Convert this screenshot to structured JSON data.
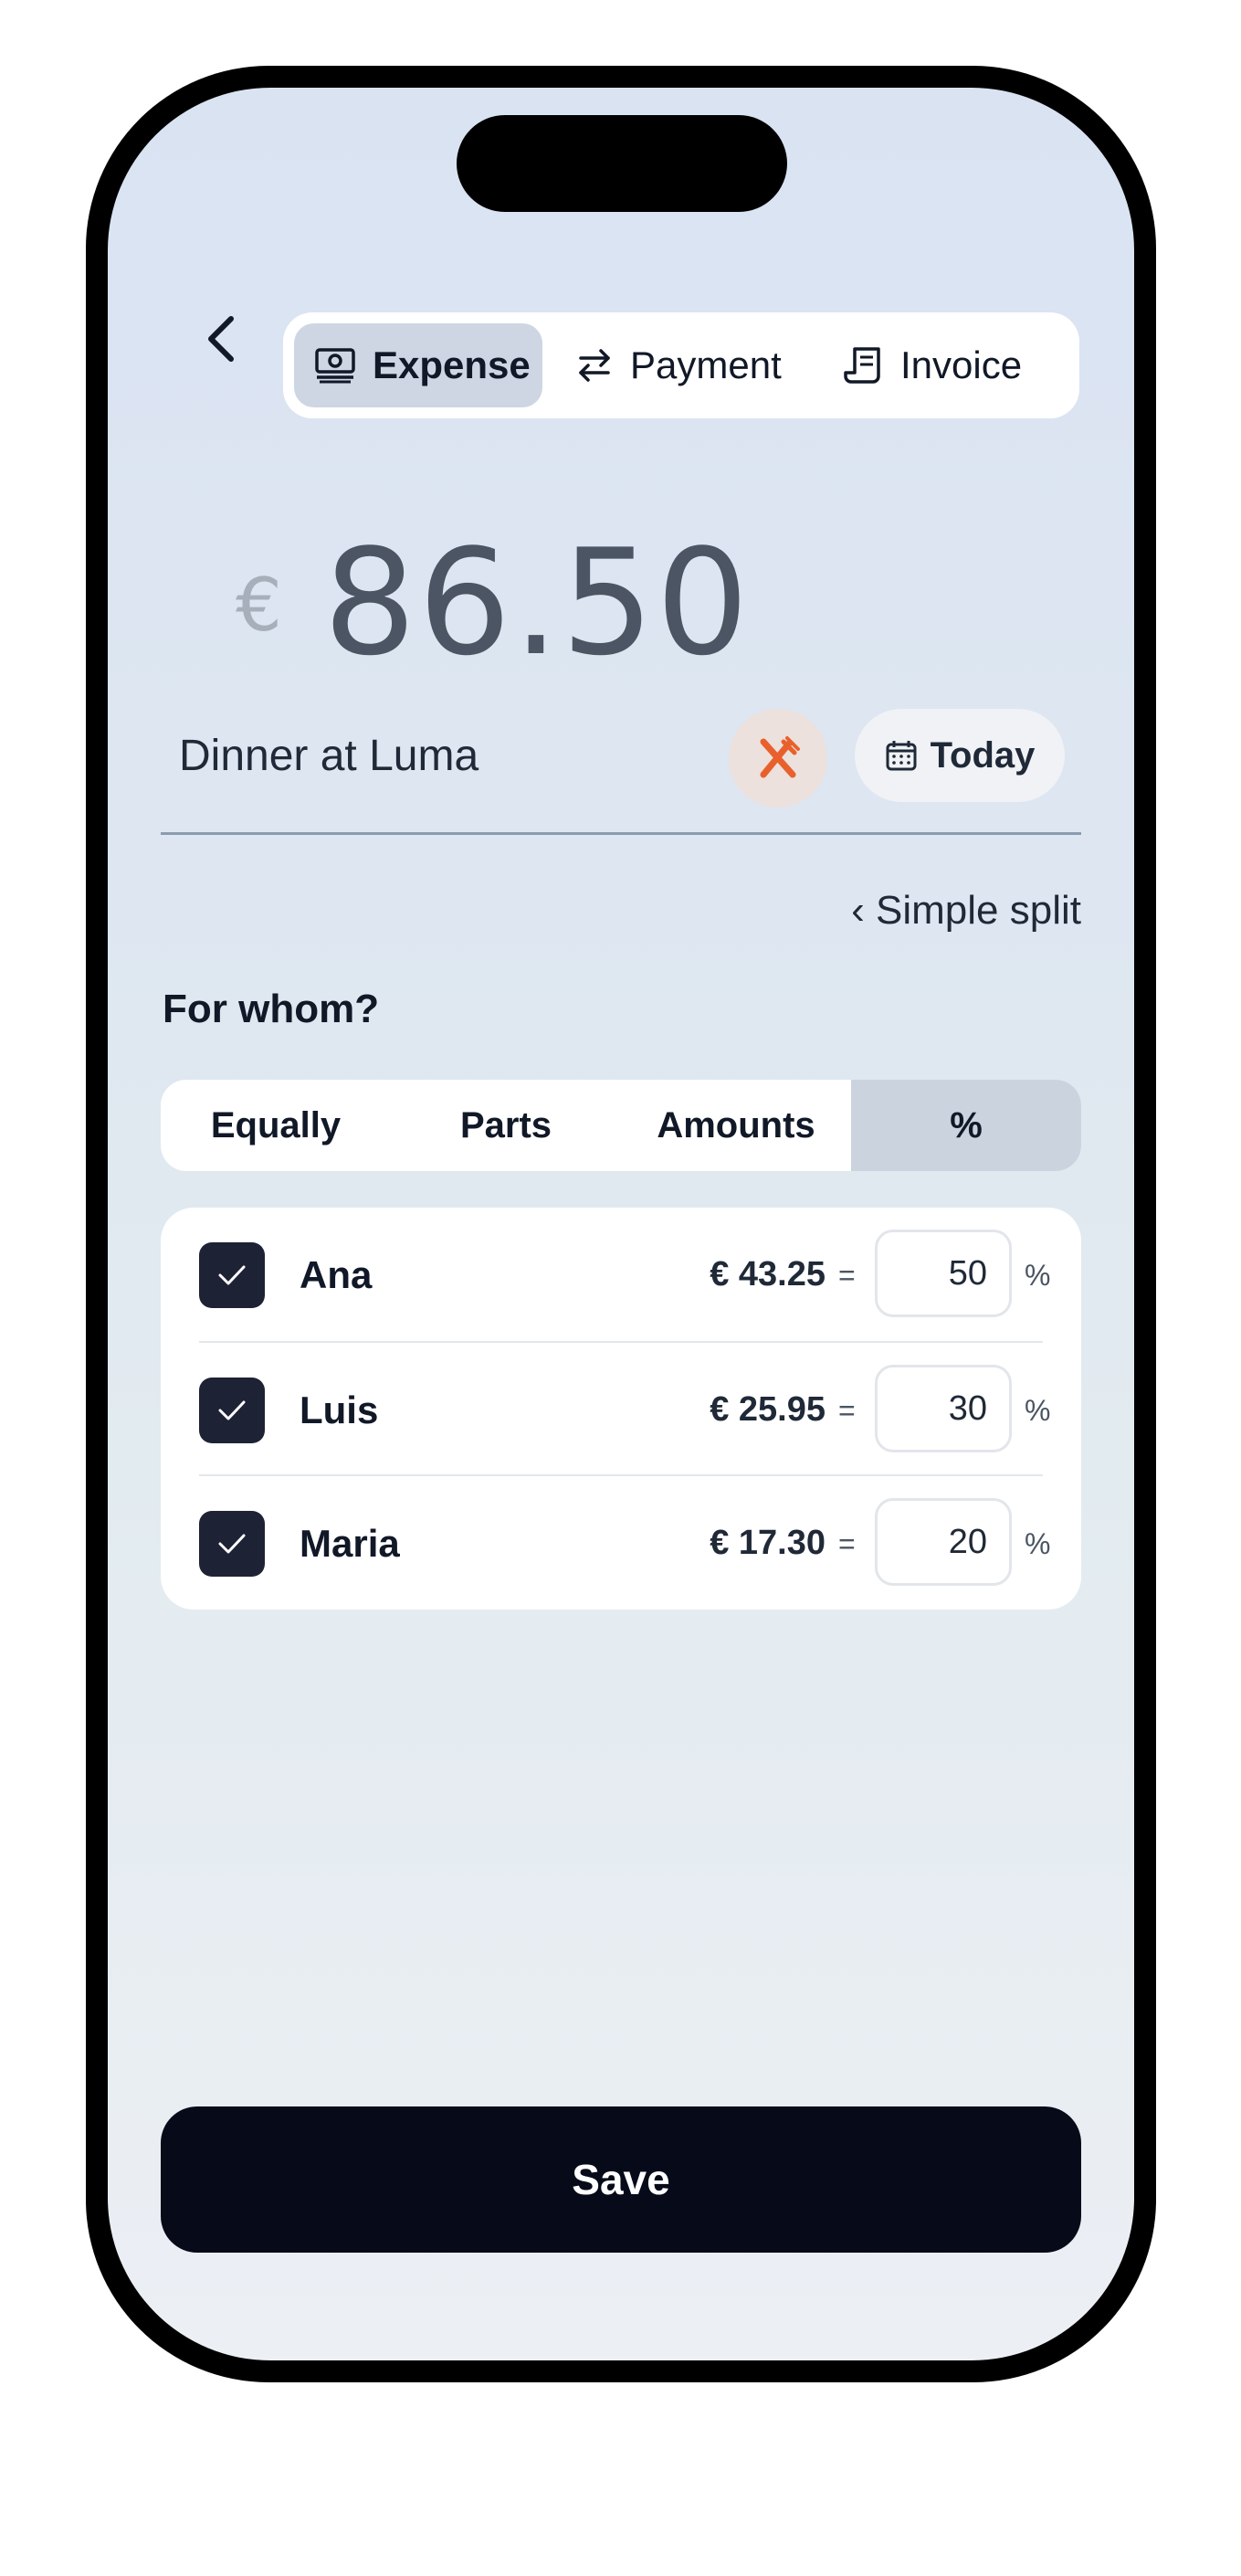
{
  "header": {
    "tabs": [
      {
        "label": "Expense",
        "icon": "banknote-icon",
        "active": true
      },
      {
        "label": "Payment",
        "icon": "transfer-arrows-icon",
        "active": false
      },
      {
        "label": "Invoice",
        "icon": "receipt-icon",
        "active": false
      }
    ]
  },
  "expense": {
    "currency_symbol": "€",
    "amount": "86.50",
    "description": "Dinner at Luma",
    "category_icon": "fork-knife-icon",
    "category_color": "#e8612c",
    "date_label": "Today"
  },
  "split": {
    "mode_link": "‹ Simple split",
    "question": "For whom?",
    "modes": [
      "Equally",
      "Parts",
      "Amounts",
      "%"
    ],
    "active_mode": "%",
    "people": [
      {
        "name": "Ana",
        "checked": true,
        "amount": "€ 43.25",
        "equals": "=",
        "percent": "50",
        "unit": "%"
      },
      {
        "name": "Luis",
        "checked": true,
        "amount": "€ 25.95",
        "equals": "=",
        "percent": "30",
        "unit": "%"
      },
      {
        "name": "Maria",
        "checked": true,
        "amount": "€ 17.30",
        "equals": "=",
        "percent": "20",
        "unit": "%"
      }
    ]
  },
  "actions": {
    "save_label": "Save"
  },
  "colors": {
    "primary": "#060a19",
    "checkbox": "#1e2235",
    "active_tab": "#cdd6e2"
  }
}
